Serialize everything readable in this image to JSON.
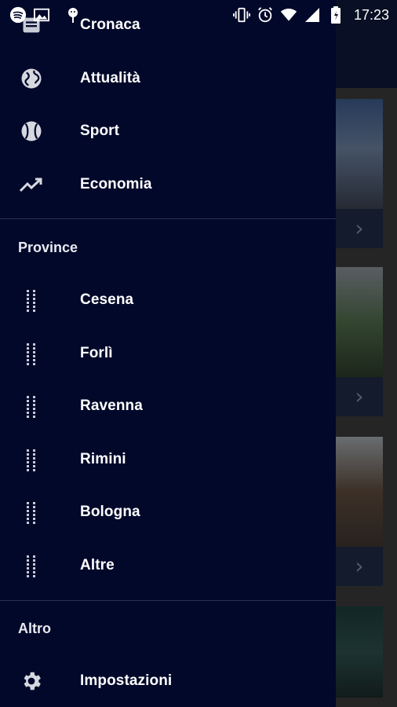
{
  "status_bar": {
    "time": "17:23",
    "left_icons": [
      "spotify-icon",
      "image-icon",
      "android-icon"
    ],
    "right_icons": [
      "vibrate-icon",
      "alarm-icon",
      "wifi-icon",
      "signal-icon",
      "battery-icon"
    ]
  },
  "drawer": {
    "categories": [
      {
        "label": "Cronaca",
        "icon": "newspaper-icon"
      },
      {
        "label": "Attualità",
        "icon": "globe-icon"
      },
      {
        "label": "Sport",
        "icon": "ball-icon"
      },
      {
        "label": "Economia",
        "icon": "trending-up-icon"
      }
    ],
    "province_header": "Province",
    "provinces": [
      {
        "label": "Cesena",
        "icon": "dotted-grid-icon"
      },
      {
        "label": "Forlì",
        "icon": "dotted-grid-icon"
      },
      {
        "label": "Ravenna",
        "icon": "dotted-grid-icon"
      },
      {
        "label": "Rimini",
        "icon": "dotted-grid-icon"
      },
      {
        "label": "Bologna",
        "icon": "dotted-grid-icon"
      },
      {
        "label": "Altre",
        "icon": "dotted-grid-icon"
      }
    ],
    "other_header": "Altro",
    "other": [
      {
        "label": "Impostazioni",
        "icon": "gear-icon"
      }
    ]
  },
  "colors": {
    "drawer_bg": "#02082a",
    "toolbar_bg": "#0f1838",
    "text": "#ffffff",
    "divider": "#2b3350"
  }
}
